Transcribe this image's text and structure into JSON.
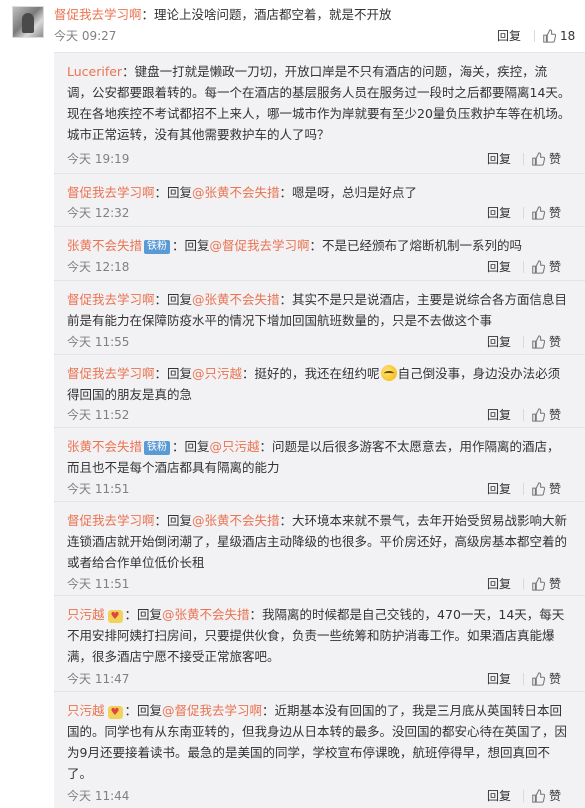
{
  "top_comment": {
    "user": "督促我去学习啊",
    "text": "：理论上没啥问题，酒店都空着，就是不开放",
    "time": "今天 09:27",
    "reply_label": "回复",
    "like_count": "18"
  },
  "replies": [
    {
      "user": "Lucerifer",
      "text": "：键盘一打就是懒政一刀切，开放口岸是不只有酒店的问题，海关，疾控，流调，公安都要跟着转的。每一个在酒店的基层服务人员在服务过一段时之后都要隔离14天。现在各地疾控不考试都招不上来人，哪一城市作为岸就要有至少20量负压救护车等在机场。城市正常运转，没有其他需要救护车的人了吗？",
      "time": "今天 19:19"
    },
    {
      "user": "督促我去学习啊",
      "reply_word": "：回复",
      "mention": "@张黄不会失措",
      "text": "：嗯是呀，总归是好点了",
      "time": "今天 12:32"
    },
    {
      "user": "张黄不会失措",
      "badge": "铁粉",
      "reply_word": "：回复",
      "mention": "@督促我去学习啊",
      "text": "：不是已经颁布了熔断机制一系列的吗",
      "time": "今天 12:18"
    },
    {
      "user": "督促我去学习啊",
      "reply_word": "：回复",
      "mention": "@张黄不会失措",
      "text": "：其实不是只是说酒店，主要是说综合各方面信息目前是有能力在保障防疫水平的情况下增加回国航班数量的，只是不去做这个事",
      "time": "今天 11:55"
    },
    {
      "user": "督促我去学习啊",
      "reply_word": "：回复",
      "mention": "@只污越",
      "text_a": "：挺好的，我还在纽约呢",
      "text_b": "自己倒没事，身边没办法必须得回国的朋友是真的急",
      "time": "今天 11:52"
    },
    {
      "user": "张黄不会失措",
      "badge": "铁粉",
      "reply_word": "：回复",
      "mention": "@只污越",
      "text": "：问题是以后很多游客不太愿意去，用作隔离的酒店，而且也不是每个酒店都具有隔离的能力",
      "time": "今天 11:51"
    },
    {
      "user": "督促我去学习啊",
      "reply_word": "：回复",
      "mention": "@张黄不会失措",
      "text": "：大环境本来就不景气，去年开始受贸易战影响大新连锁酒店就开始倒闭潮了，星级酒店主动降级的也很多。平价房还好，高级房基本都空着的或者给合作单位低价长租",
      "time": "今天 11:51"
    },
    {
      "user": "只污越",
      "heart": "♥",
      "reply_word": "：回复",
      "mention": "@张黄不会失措",
      "text": "：我隔离的时候都是自己交钱的，470一天，14天，每天不用安排阿姨打扫房间，只要提供伙食，负责一些统筹和防护消毒工作。如果酒店真能爆满，很多酒店宁愿不接受正常旅客吧。",
      "time": "今天 11:47"
    },
    {
      "user": "只污越",
      "heart": "♥",
      "reply_word": "：回复",
      "mention": "@督促我去学习啊",
      "text": "：近期基本没有回国的了，我是三月底从英国转日本回国的。同学也有从东南亚转的，但我身边从日本转的最多。没回国的都安心待在英国了，因为9月还要接着读书。最急的是美国的同学，学校宣布停课晚，航班停得早，想回真回不了。",
      "time": "今天 11:44"
    }
  ],
  "labels": {
    "reply": "回复",
    "like": "赞"
  },
  "colors": {
    "username": "#eb7350",
    "reply_bg": "#f2f2f5",
    "fan_badge": "#5b9bd5"
  }
}
